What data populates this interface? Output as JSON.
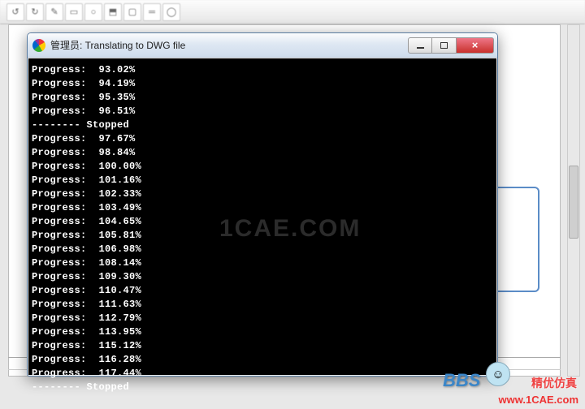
{
  "background": {
    "toolbar_buttons": [
      "↺",
      "↻",
      "✎",
      "▭",
      "○",
      "⬒",
      "▢",
      "═",
      "◯"
    ]
  },
  "window": {
    "title": "管理员: Translating to DWG file",
    "buttons": {
      "minimize": "–",
      "maximize": "□",
      "close": "×"
    }
  },
  "console_lines": [
    "Progress:  93.02%",
    "Progress:  94.19%",
    "Progress:  95.35%",
    "Progress:  96.51%",
    "-------- Stopped",
    "Progress:  97.67%",
    "Progress:  98.84%",
    "Progress:  100.00%",
    "Progress:  101.16%",
    "Progress:  102.33%",
    "Progress:  103.49%",
    "Progress:  104.65%",
    "Progress:  105.81%",
    "Progress:  106.98%",
    "Progress:  108.14%",
    "Progress:  109.30%",
    "Progress:  110.47%",
    "Progress:  111.63%",
    "Progress:  112.79%",
    "Progress:  113.95%",
    "Progress:  115.12%",
    "Progress:  116.28%",
    "Progress:  117.44%",
    "-------- Stopped"
  ],
  "watermarks": {
    "center": "1CAE.COM",
    "bbs": "BBS",
    "site_cn": "精优仿真",
    "site_url": "www.1CAE.com"
  }
}
